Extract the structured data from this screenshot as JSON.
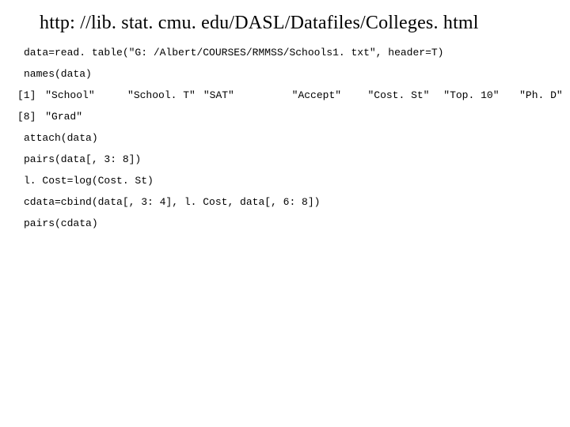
{
  "title": "http: //lib. stat. cmu. edu/DASL/Datafiles/Colleges. html",
  "code": {
    "l1": "data=read. table(\"G: /Albert/COURSES/RMMSS/Schools1. txt\", header=T)",
    "l2": "names(data)",
    "row1": {
      "idx": "[1]",
      "c1": "\"School\"",
      "c2": "\"School. T\"",
      "c3": "\"SAT\"",
      "c4": "\"Accept\"",
      "c5": "\"Cost. St\"",
      "c6": "\"Top. 10\"",
      "c7": "\"Ph. D\""
    },
    "row2": {
      "idx": "[8]",
      "c1": "\"Grad\""
    },
    "l5": "attach(data)",
    "l6": "pairs(data[, 3: 8])",
    "l7": "l. Cost=log(Cost. St)",
    "l8": "cdata=cbind(data[, 3: 4], l. Cost, data[, 6: 8])",
    "l9": "pairs(cdata)"
  }
}
